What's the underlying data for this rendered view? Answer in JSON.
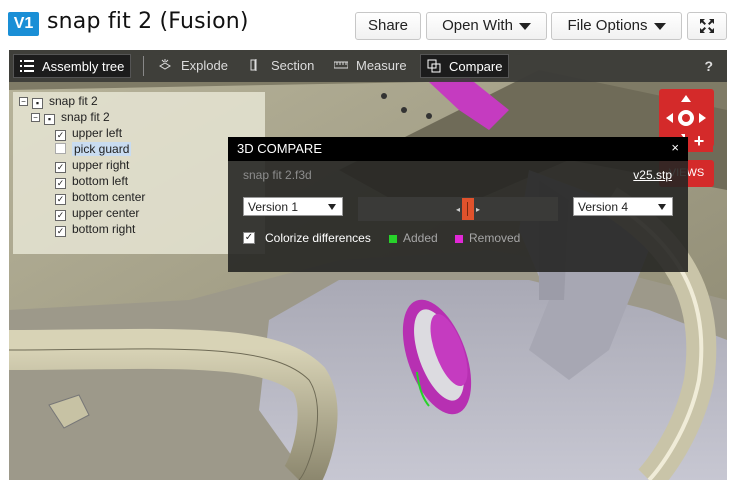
{
  "header": {
    "version_badge": "V1",
    "title": "snap fit 2 (Fusion)",
    "share_label": "Share",
    "open_with_label": "Open With",
    "file_options_label": "File Options"
  },
  "toolbar": {
    "assembly_tree": "Assembly tree",
    "explode": "Explode",
    "section": "Section",
    "measure": "Measure",
    "compare": "Compare",
    "help": "?"
  },
  "tree": {
    "root": "snap fit 2",
    "child": "snap fit 2",
    "items": [
      {
        "label": "upper left",
        "checked": true
      },
      {
        "label": "pick guard",
        "checked": false,
        "selected": true
      },
      {
        "label": "upper right",
        "checked": true
      },
      {
        "label": "bottom left",
        "checked": true
      },
      {
        "label": "bottom center",
        "checked": true
      },
      {
        "label": "upper center",
        "checked": true
      },
      {
        "label": "bottom right",
        "checked": true
      }
    ]
  },
  "views": {
    "views_label": "VIEWS",
    "plus": "+"
  },
  "compare_panel": {
    "title": "3D COMPARE",
    "close": "×",
    "file_a": "snap fit 2.f3d",
    "file_b": "v25.stp",
    "version_a": "Version 1",
    "version_b": "Version 4",
    "colorize_label": "Colorize differences",
    "added_label": "Added",
    "removed_label": "Removed",
    "added_color": "#27d22a",
    "removed_color": "#e128d6"
  }
}
